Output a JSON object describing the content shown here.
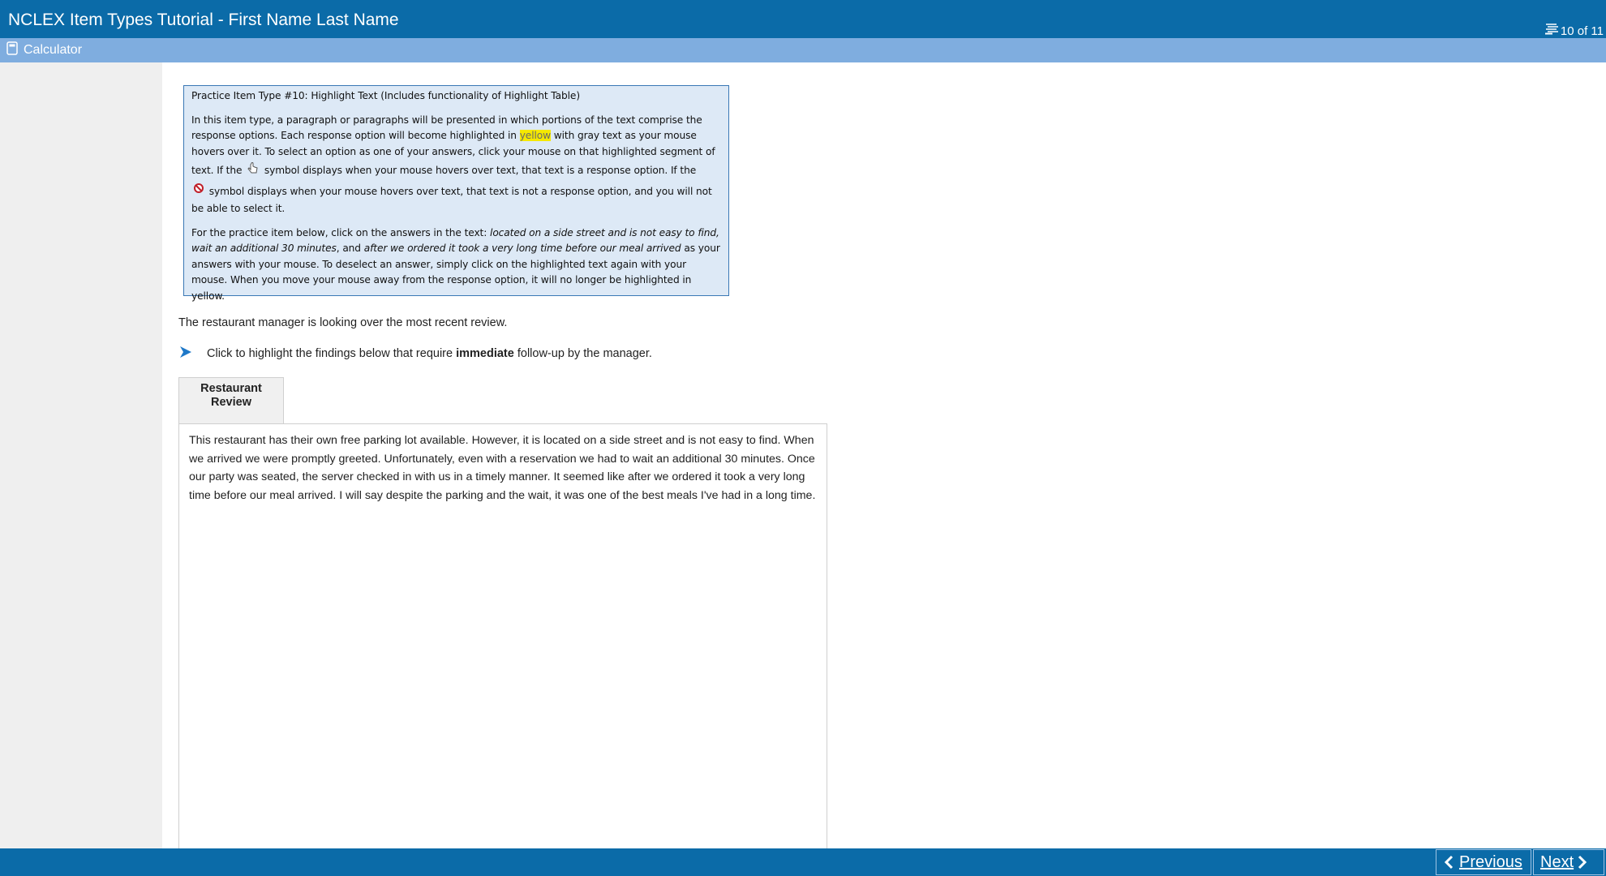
{
  "header": {
    "title": "NCLEX Item Types Tutorial - First Name Last Name",
    "progress": "10 of 11"
  },
  "toolbar": {
    "calculator_label": "Calculator"
  },
  "instructions": {
    "title": "Practice Item Type #10: Highlight Text (Includes functionality of Highlight Table)",
    "p1_a": "In this item type, a paragraph or paragraphs will be presented in which portions of the text comprise the response options. Each response option will become highlighted in ",
    "p1_highlight": "yellow",
    "p1_b": " with gray text as your mouse hovers over it. To select an option as one of your answers, click your mouse on that highlighted segment of text. If the ",
    "p1_c": " symbol displays when your mouse hovers over text, that text is a response option. If the ",
    "p1_d": " symbol displays when your mouse hovers over text, that text is not a response option, and you will not be able to select it.",
    "p2_a": "For the practice item below, click on the answers in the text: ",
    "p2_i1": "located on a side street and is not easy to find, wait an additional 30 minutes",
    "p2_b": ", and ",
    "p2_i2": "after we ordered it took a very long time before our meal arrived",
    "p2_c": " as your answers with your mouse. To deselect an answer, simply click on the highlighted text again with your mouse. When you move your mouse away from the response option, it will no longer be highlighted in yellow."
  },
  "question": {
    "stem": "The restaurant manager is looking over the most recent review.",
    "prompt_a": "Click to highlight the findings below that require ",
    "prompt_bold": "immediate",
    "prompt_b": " follow-up by the manager."
  },
  "tab": {
    "line1": "Restaurant",
    "line2": "Review"
  },
  "review_text": "This restaurant has their own free parking lot available. However, it is located on a side street and is not easy to find. When we arrived we were promptly greeted. Unfortunately, even with a reservation we had to wait an additional 30 minutes. Once our party was seated, the server checked in with us in a timely manner. It seemed like after we ordered it took a very long time before our meal arrived. I will say despite the parking and the wait, it was one of the best meals I've had in a long time.",
  "footer": {
    "previous_label": "Previous",
    "next_label": "Next"
  },
  "colors": {
    "header": "#0b6ba8",
    "toolbar": "#7faddf",
    "instructions_bg": "#dde9f6",
    "highlight": "#f5e800"
  },
  "icons": {
    "progress": "question-list-icon",
    "calculator": "calculator-icon",
    "hand": "hand-pointer-icon",
    "not_allowed": "not-allowed-icon",
    "prompt": "arrow-pointer-icon",
    "previous": "chevron-left-icon",
    "next": "chevron-right-icon"
  }
}
